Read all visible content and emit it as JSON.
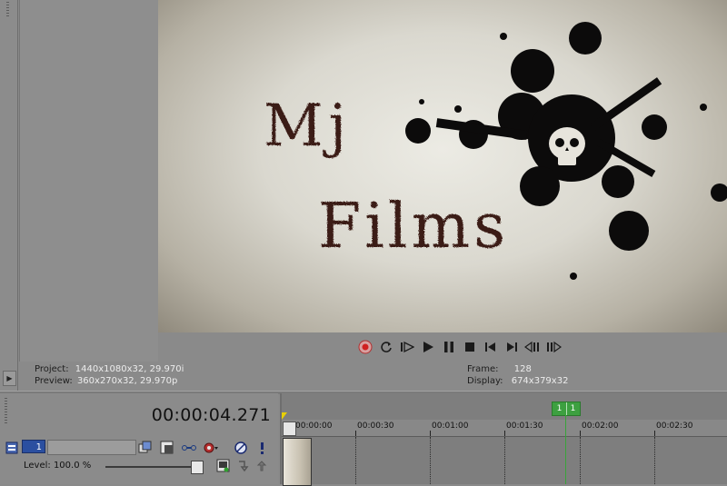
{
  "preview": {
    "title_line1": "Mj",
    "title_line2": "Films"
  },
  "transport": {
    "buttons": [
      "record",
      "loop",
      "play-from-start",
      "play",
      "pause",
      "stop",
      "prev-frame-start",
      "next-frame-end",
      "prev-frame",
      "next-frame"
    ]
  },
  "info": {
    "project_label": "Project:",
    "project_value": "1440x1080x32, 29.970i",
    "preview_label": "Preview:",
    "preview_value": "360x270x32, 29.970p",
    "frame_label": "Frame:",
    "frame_value": "128",
    "display_label": "Display:",
    "display_value": "674x379x32"
  },
  "timeline": {
    "timecode": "00:00:04.271",
    "ruler_labels": [
      "00:00:00",
      "00:00:30",
      "00:01:00",
      "00:01:30",
      "00:02:00",
      "00:02:30"
    ],
    "marker_labels": [
      "1",
      "1"
    ]
  },
  "track": {
    "number": "1",
    "level_label": "Level: 100.0 %",
    "level_value": 100.0
  },
  "colors": {
    "marker": "#3da040",
    "track_number_bg": "#2b4fa0",
    "record_red": "#d02020"
  }
}
